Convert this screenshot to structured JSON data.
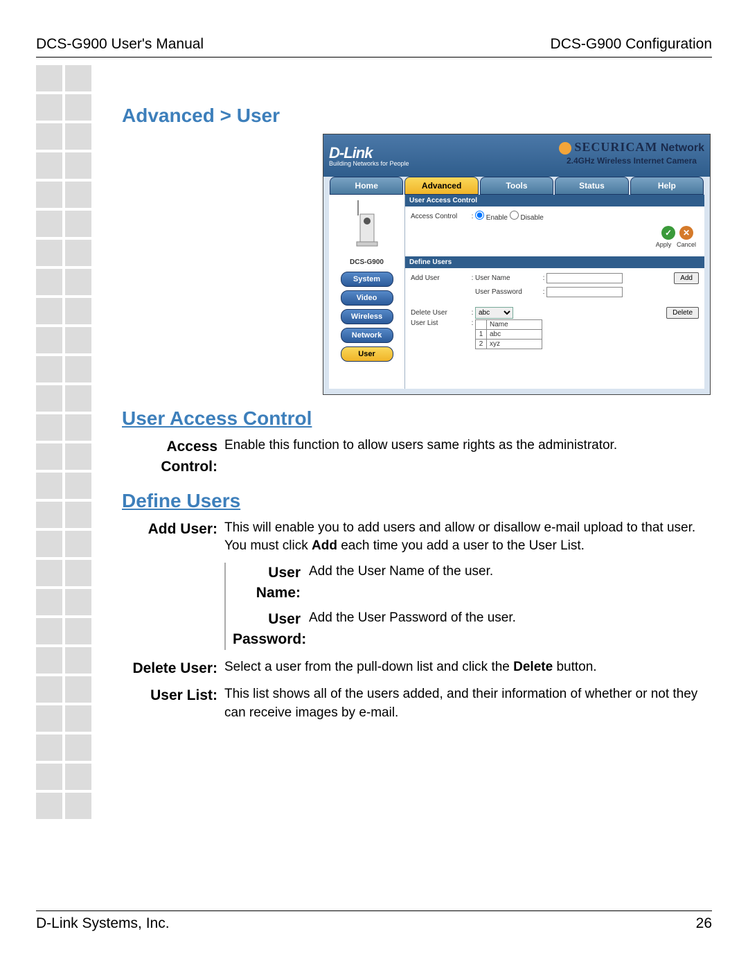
{
  "header": {
    "left": "DCS-G900 User's Manual",
    "right": "DCS-G900 Configuration"
  },
  "footer": {
    "left": "D-Link Systems, Inc.",
    "page": "26"
  },
  "title": "Advanced > User",
  "shot": {
    "logo": "D-Link",
    "tagline": "Building Networks for People",
    "brand_a": "SECURICAM",
    "brand_b": "Network",
    "subtitle": "2.4GHz Wireless Internet Camera",
    "tabs": [
      "Home",
      "Advanced",
      "Tools",
      "Status",
      "Help"
    ],
    "model": "DCS-G900",
    "nav": [
      "System",
      "Video",
      "Wireless",
      "Network",
      "User"
    ],
    "s1": "User Access Control",
    "access_label": "Access Control",
    "enable": "Enable",
    "disable": "Disable",
    "apply": "Apply",
    "cancel": "Cancel",
    "s2": "Define Users",
    "adduser": "Add User",
    "uname": "User Name",
    "upass": "User Password",
    "addbtn": "Add",
    "deluser": "Delete User",
    "selval": "abc",
    "delbtn": "Delete",
    "ulist": "User List",
    "th": "Name",
    "r1": "abc",
    "r2": "xyz"
  },
  "sec1_title": "User Access Control",
  "sec1": {
    "label": "Access Control:",
    "text": "Enable this function to allow users same rights as the administrator."
  },
  "sec2_title": "Define Users",
  "adduser": {
    "label": "Add User:",
    "text_a": "This will enable you to add users and allow or disallow e-mail upload to that user. You must click ",
    "bold": "Add",
    "text_b": " each time you add a user to the User List."
  },
  "uname": {
    "label": "User Name:",
    "text": "Add the User Name of the user."
  },
  "upass": {
    "label": "User Password:",
    "text": "Add the User Password of the user."
  },
  "deluser": {
    "label": "Delete User:",
    "text_a": "Select a user from the pull-down list and click the ",
    "bold": "Delete",
    "text_b": " button."
  },
  "ulist": {
    "label": "User List:",
    "text": "This list shows all of the users added, and their information of whether or not they can receive images by e-mail."
  }
}
